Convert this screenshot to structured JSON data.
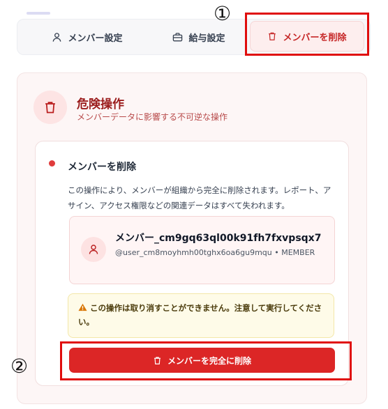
{
  "tabs": {
    "members_label": "メンバー設定",
    "payroll_label": "給与設定",
    "delete_label": "メンバーを削除"
  },
  "callouts": {
    "step1": "①",
    "step2": "②"
  },
  "danger": {
    "title": "危険操作",
    "subtitle": "メンバーデータに影響する不可逆な操作"
  },
  "card": {
    "title": "メンバーを削除",
    "description": "この操作により、メンバーが組織から完全に削除されます。レポート、アサイン、アクセス権限などの関連データはすべて失われます。"
  },
  "member": {
    "name": "メンバー_cm9gq63ql00k91fh7fxvpsqx7",
    "meta": "@user_cm8moyhmh00tghx6oa6gu9mqu • MEMBER"
  },
  "warning": {
    "text": "この操作は取り消すことができません。注意して実行してください。"
  },
  "delete_button": {
    "label": "メンバーを完全に削除"
  },
  "colors": {
    "danger": "#dc2626",
    "danger_dark": "#9b1c1c",
    "highlight": "#e00d0d",
    "warning_bg": "#fefbe8"
  }
}
